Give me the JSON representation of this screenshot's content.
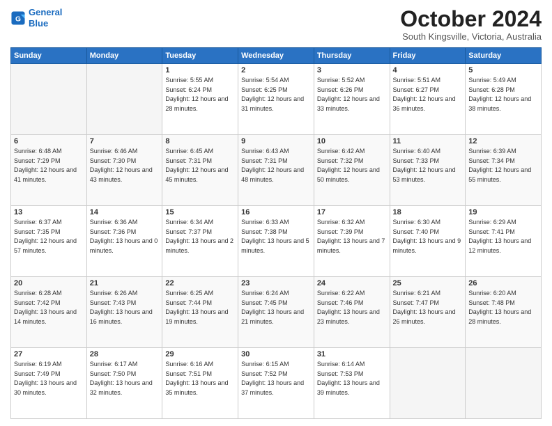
{
  "header": {
    "logo_line1": "General",
    "logo_line2": "Blue",
    "month": "October 2024",
    "location": "South Kingsville, Victoria, Australia"
  },
  "days_of_week": [
    "Sunday",
    "Monday",
    "Tuesday",
    "Wednesday",
    "Thursday",
    "Friday",
    "Saturday"
  ],
  "weeks": [
    [
      {
        "day": "",
        "sunrise": "",
        "sunset": "",
        "daylight": "",
        "empty": true
      },
      {
        "day": "",
        "sunrise": "",
        "sunset": "",
        "daylight": "",
        "empty": true
      },
      {
        "day": "1",
        "sunrise": "Sunrise: 5:55 AM",
        "sunset": "Sunset: 6:24 PM",
        "daylight": "Daylight: 12 hours and 28 minutes."
      },
      {
        "day": "2",
        "sunrise": "Sunrise: 5:54 AM",
        "sunset": "Sunset: 6:25 PM",
        "daylight": "Daylight: 12 hours and 31 minutes."
      },
      {
        "day": "3",
        "sunrise": "Sunrise: 5:52 AM",
        "sunset": "Sunset: 6:26 PM",
        "daylight": "Daylight: 12 hours and 33 minutes."
      },
      {
        "day": "4",
        "sunrise": "Sunrise: 5:51 AM",
        "sunset": "Sunset: 6:27 PM",
        "daylight": "Daylight: 12 hours and 36 minutes."
      },
      {
        "day": "5",
        "sunrise": "Sunrise: 5:49 AM",
        "sunset": "Sunset: 6:28 PM",
        "daylight": "Daylight: 12 hours and 38 minutes."
      }
    ],
    [
      {
        "day": "6",
        "sunrise": "Sunrise: 6:48 AM",
        "sunset": "Sunset: 7:29 PM",
        "daylight": "Daylight: 12 hours and 41 minutes."
      },
      {
        "day": "7",
        "sunrise": "Sunrise: 6:46 AM",
        "sunset": "Sunset: 7:30 PM",
        "daylight": "Daylight: 12 hours and 43 minutes."
      },
      {
        "day": "8",
        "sunrise": "Sunrise: 6:45 AM",
        "sunset": "Sunset: 7:31 PM",
        "daylight": "Daylight: 12 hours and 45 minutes."
      },
      {
        "day": "9",
        "sunrise": "Sunrise: 6:43 AM",
        "sunset": "Sunset: 7:31 PM",
        "daylight": "Daylight: 12 hours and 48 minutes."
      },
      {
        "day": "10",
        "sunrise": "Sunrise: 6:42 AM",
        "sunset": "Sunset: 7:32 PM",
        "daylight": "Daylight: 12 hours and 50 minutes."
      },
      {
        "day": "11",
        "sunrise": "Sunrise: 6:40 AM",
        "sunset": "Sunset: 7:33 PM",
        "daylight": "Daylight: 12 hours and 53 minutes."
      },
      {
        "day": "12",
        "sunrise": "Sunrise: 6:39 AM",
        "sunset": "Sunset: 7:34 PM",
        "daylight": "Daylight: 12 hours and 55 minutes."
      }
    ],
    [
      {
        "day": "13",
        "sunrise": "Sunrise: 6:37 AM",
        "sunset": "Sunset: 7:35 PM",
        "daylight": "Daylight: 12 hours and 57 minutes."
      },
      {
        "day": "14",
        "sunrise": "Sunrise: 6:36 AM",
        "sunset": "Sunset: 7:36 PM",
        "daylight": "Daylight: 13 hours and 0 minutes."
      },
      {
        "day": "15",
        "sunrise": "Sunrise: 6:34 AM",
        "sunset": "Sunset: 7:37 PM",
        "daylight": "Daylight: 13 hours and 2 minutes."
      },
      {
        "day": "16",
        "sunrise": "Sunrise: 6:33 AM",
        "sunset": "Sunset: 7:38 PM",
        "daylight": "Daylight: 13 hours and 5 minutes."
      },
      {
        "day": "17",
        "sunrise": "Sunrise: 6:32 AM",
        "sunset": "Sunset: 7:39 PM",
        "daylight": "Daylight: 13 hours and 7 minutes."
      },
      {
        "day": "18",
        "sunrise": "Sunrise: 6:30 AM",
        "sunset": "Sunset: 7:40 PM",
        "daylight": "Daylight: 13 hours and 9 minutes."
      },
      {
        "day": "19",
        "sunrise": "Sunrise: 6:29 AM",
        "sunset": "Sunset: 7:41 PM",
        "daylight": "Daylight: 13 hours and 12 minutes."
      }
    ],
    [
      {
        "day": "20",
        "sunrise": "Sunrise: 6:28 AM",
        "sunset": "Sunset: 7:42 PM",
        "daylight": "Daylight: 13 hours and 14 minutes."
      },
      {
        "day": "21",
        "sunrise": "Sunrise: 6:26 AM",
        "sunset": "Sunset: 7:43 PM",
        "daylight": "Daylight: 13 hours and 16 minutes."
      },
      {
        "day": "22",
        "sunrise": "Sunrise: 6:25 AM",
        "sunset": "Sunset: 7:44 PM",
        "daylight": "Daylight: 13 hours and 19 minutes."
      },
      {
        "day": "23",
        "sunrise": "Sunrise: 6:24 AM",
        "sunset": "Sunset: 7:45 PM",
        "daylight": "Daylight: 13 hours and 21 minutes."
      },
      {
        "day": "24",
        "sunrise": "Sunrise: 6:22 AM",
        "sunset": "Sunset: 7:46 PM",
        "daylight": "Daylight: 13 hours and 23 minutes."
      },
      {
        "day": "25",
        "sunrise": "Sunrise: 6:21 AM",
        "sunset": "Sunset: 7:47 PM",
        "daylight": "Daylight: 13 hours and 26 minutes."
      },
      {
        "day": "26",
        "sunrise": "Sunrise: 6:20 AM",
        "sunset": "Sunset: 7:48 PM",
        "daylight": "Daylight: 13 hours and 28 minutes."
      }
    ],
    [
      {
        "day": "27",
        "sunrise": "Sunrise: 6:19 AM",
        "sunset": "Sunset: 7:49 PM",
        "daylight": "Daylight: 13 hours and 30 minutes."
      },
      {
        "day": "28",
        "sunrise": "Sunrise: 6:17 AM",
        "sunset": "Sunset: 7:50 PM",
        "daylight": "Daylight: 13 hours and 32 minutes."
      },
      {
        "day": "29",
        "sunrise": "Sunrise: 6:16 AM",
        "sunset": "Sunset: 7:51 PM",
        "daylight": "Daylight: 13 hours and 35 minutes."
      },
      {
        "day": "30",
        "sunrise": "Sunrise: 6:15 AM",
        "sunset": "Sunset: 7:52 PM",
        "daylight": "Daylight: 13 hours and 37 minutes."
      },
      {
        "day": "31",
        "sunrise": "Sunrise: 6:14 AM",
        "sunset": "Sunset: 7:53 PM",
        "daylight": "Daylight: 13 hours and 39 minutes."
      },
      {
        "day": "",
        "sunrise": "",
        "sunset": "",
        "daylight": "",
        "empty": true
      },
      {
        "day": "",
        "sunrise": "",
        "sunset": "",
        "daylight": "",
        "empty": true
      }
    ]
  ]
}
